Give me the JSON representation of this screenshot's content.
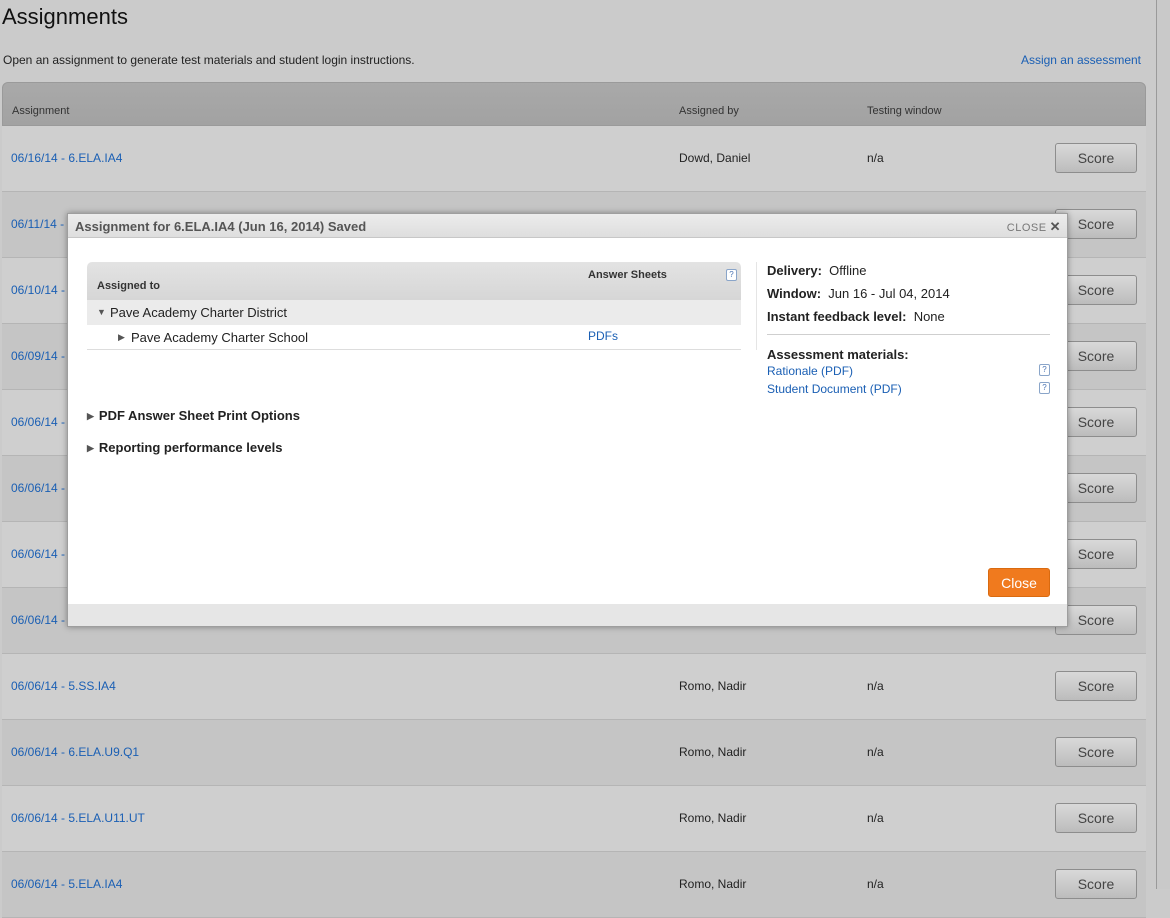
{
  "page": {
    "title": "Assignments",
    "subtitle": "Open an assignment to generate test materials and student login instructions.",
    "assign_link": "Assign an assessment"
  },
  "table": {
    "headers": {
      "assignment": "Assignment",
      "assigned_by": "Assigned by",
      "testing_window": "Testing window"
    },
    "score_label": "Score",
    "rows": [
      {
        "name": "06/16/14 - 6.ELA.IA4",
        "by": "Dowd, Daniel",
        "window": "n/a"
      },
      {
        "name": "06/11/14 -",
        "by": "",
        "window": ""
      },
      {
        "name": "06/10/14 -",
        "by": "",
        "window": ""
      },
      {
        "name": "06/09/14 -",
        "by": "",
        "window": ""
      },
      {
        "name": "06/06/14 -",
        "by": "",
        "window": ""
      },
      {
        "name": "06/06/14 -",
        "by": "",
        "window": ""
      },
      {
        "name": "06/06/14 -",
        "by": "",
        "window": ""
      },
      {
        "name": "06/06/14 -",
        "by": "",
        "window": ""
      },
      {
        "name": "06/06/14 - 5.SS.IA4",
        "by": "Romo, Nadir",
        "window": "n/a"
      },
      {
        "name": "06/06/14 - 6.ELA.U9.Q1",
        "by": "Romo, Nadir",
        "window": "n/a"
      },
      {
        "name": "06/06/14 - 5.ELA.U11.UT",
        "by": "Romo, Nadir",
        "window": "n/a"
      },
      {
        "name": "06/06/14 - 5.ELA.IA4",
        "by": "Romo, Nadir",
        "window": "n/a"
      }
    ]
  },
  "modal": {
    "title": "Assignment for 6.ELA.IA4 (Jun 16, 2014) Saved",
    "close_x": "CLOSE",
    "assigned_to_header": "Assigned to",
    "answer_sheets_header": "Answer Sheets",
    "help": "?",
    "district": "Pave Academy Charter District",
    "school": "Pave Academy Charter School",
    "pdfs_link": "PDFs",
    "delivery_label": "Delivery:",
    "delivery_value": "Offline",
    "window_label": "Window:",
    "window_value": "Jun 16 - Jul 04, 2014",
    "feedback_label": "Instant feedback level:",
    "feedback_value": "None",
    "materials_label": "Assessment materials:",
    "rationale_link": "Rationale (PDF)",
    "student_doc_link": "Student Document (PDF)",
    "print_options": "PDF Answer Sheet Print Options",
    "reporting_levels": "Reporting performance levels",
    "close_button": "Close"
  },
  "colors": {
    "link": "#1a5fb4",
    "close_button": "#f07a1e"
  }
}
